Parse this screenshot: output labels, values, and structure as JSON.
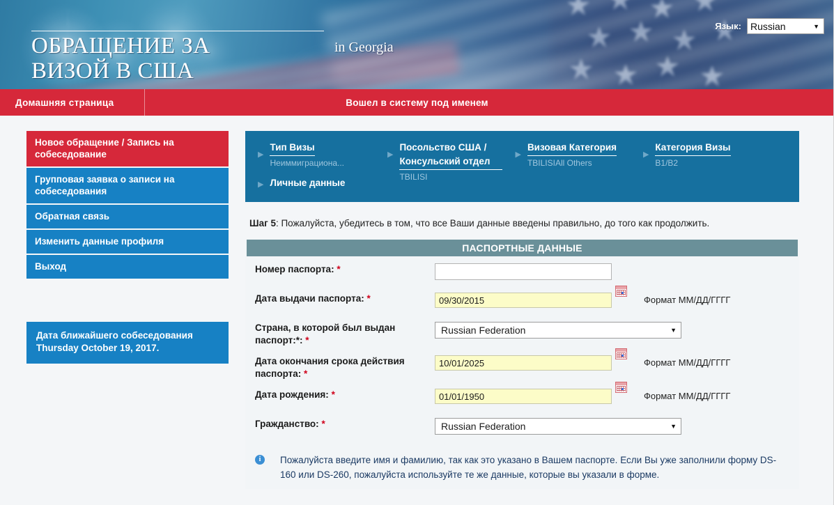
{
  "banner": {
    "title": "ОБРАЩЕНИЕ ЗА\nВИЗОЙ В США",
    "subtitle": "in Georgia",
    "language_label": "Язык:",
    "language_value": "Russian",
    "caret": "▼"
  },
  "navbar": {
    "home_label": "Домашняя страница",
    "logged_in_label": "Вошел в систему под именем"
  },
  "sidebar": {
    "items": [
      {
        "label": "Новое обращение / Запись на собеседование",
        "active": true
      },
      {
        "label": "Групповая заявка о записи на собеседования",
        "active": false
      },
      {
        "label": "Обратная связь",
        "active": false
      },
      {
        "label": "Изменить данные профиля",
        "active": false
      },
      {
        "label": "Выход",
        "active": false
      }
    ],
    "next_date_box": "Дата ближайшего собеседования Thursday October 19, 2017."
  },
  "stepper": {
    "arrow_glyph": "▶",
    "steps": [
      {
        "title": "Тип Визы",
        "value": "Неиммиграциона..."
      },
      {
        "title": "Личные данные",
        "value": ""
      },
      {
        "title": "Посольство США / Консульский отдел",
        "value": "TBILISI"
      },
      {
        "title": "Визовая Категория",
        "value": "TBILISIAll Others"
      },
      {
        "title": "Категория Визы",
        "value": "B1/B2"
      }
    ]
  },
  "instruction": {
    "step_label": "Шаг 5",
    "text": ": Пожалуйста, убедитесь в том, что все Ваши данные введены правильно, до того как продолжить."
  },
  "form": {
    "heading": "ПАСПОРТНЫЕ ДАННЫЕ",
    "required_marker": "*",
    "date_format_hint": "Формат ММ/ДД/ГГГГ",
    "select_caret": "▼",
    "fields": [
      {
        "label": "Номер паспорта:",
        "type": "text",
        "value": "",
        "placeholder": ""
      },
      {
        "label": "Дата выдачи паспорта:",
        "type": "date",
        "value": "09/30/2015"
      },
      {
        "label": "Страна, в которой был выдан паспорт:*:",
        "type": "select",
        "value": "Russian Federation"
      },
      {
        "label": "Дата окончания срока действия паспорта:",
        "type": "date",
        "value": "10/01/2025"
      },
      {
        "label": "Дата рождения:",
        "type": "date",
        "value": "01/01/1950"
      },
      {
        "label": "Гражданство:",
        "type": "select",
        "value": "Russian Federation"
      }
    ],
    "note": "Пожалуйста введите имя и фамилию, так как это указано в Вашем паспорте. Если Вы уже заполнили форму DS-160 или DS-260, пожалуйста используйте те же данные, которые вы указали в форме.",
    "note_icon_glyph": "i"
  },
  "colors": {
    "brand_red": "#d6283a",
    "brand_blue": "#1781c4",
    "stepper_blue": "#16709f",
    "panel_header": "#6a9099",
    "required_red": "#d0021b",
    "date_field_yellow": "#fcfcc8"
  }
}
